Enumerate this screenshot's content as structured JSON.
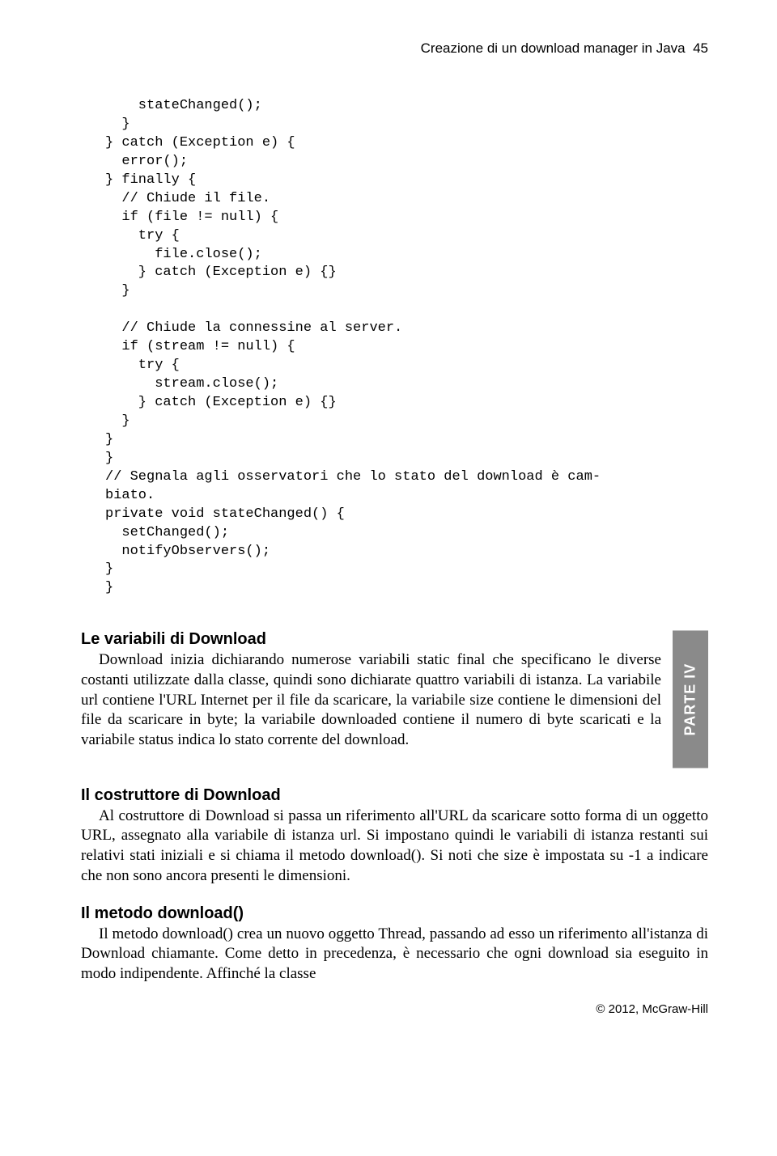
{
  "header": {
    "running_title": "Creazione di un download manager in Java",
    "page_number": "45"
  },
  "code": "    stateChanged();\n  }\n} catch (Exception e) {\n  error();\n} finally {\n  // Chiude il file.\n  if (file != null) {\n    try {\n      file.close();\n    } catch (Exception e) {}\n  }\n\n  // Chiude la connessine al server.\n  if (stream != null) {\n    try {\n      stream.close();\n    } catch (Exception e) {}\n  }\n}\n}\n// Segnala agli osservatori che lo stato del download è cam-\nbiato.\nprivate void stateChanged() {\n  setChanged();\n  notifyObservers();\n}\n}",
  "sections": [
    {
      "title": "Le variabili di Download",
      "body": "Download inizia dichiarando numerose variabili static final che specificano le diverse costanti utilizzate dalla classe, quindi sono dichiarate quattro variabili di istanza. La variabile url contiene l'URL Internet per il file da scaricare, la variabile size contiene le dimensioni del file da scaricare in byte; la variabile downloaded contiene il numero di byte scaricati e la variabile status indica lo stato corrente del download."
    },
    {
      "title": "Il costruttore di Download",
      "body": "Al costruttore di Download si passa un riferimento all'URL da scaricare sotto forma di un oggetto URL, assegnato alla variabile di istanza url. Si impostano quindi le variabili di istanza restanti sui relativi stati iniziali e si chiama il metodo download(). Si noti che size è impostata su -1 a indicare che non sono ancora presenti le dimensioni."
    },
    {
      "title": "Il metodo download()",
      "body": "Il metodo download() crea un nuovo oggetto Thread, passando ad esso un riferimento all'istanza di Download chiamante. Come detto in precedenza, è necessario che ogni download sia eseguito in modo indipendente. Affinché la classe"
    }
  ],
  "sidebar": {
    "label": "PARTE IV"
  },
  "footer": {
    "copyright": "© 2012, McGraw-Hill"
  }
}
